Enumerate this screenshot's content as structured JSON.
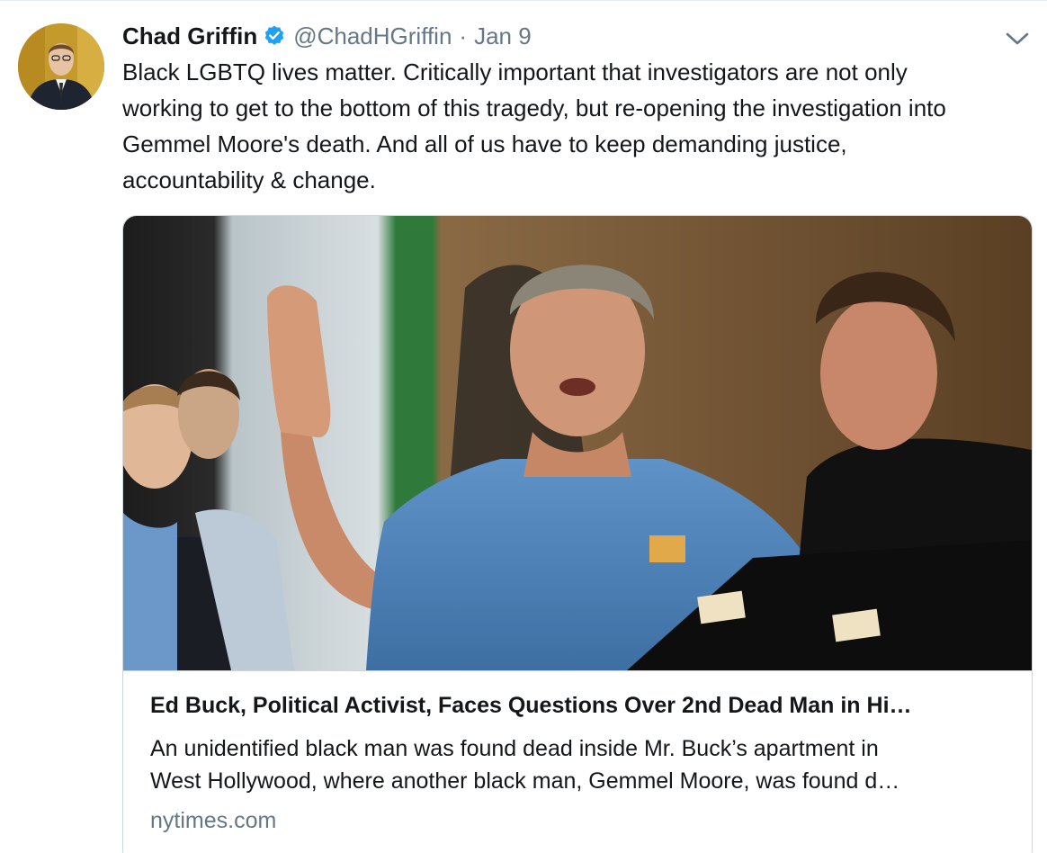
{
  "author": {
    "display_name": "Chad Griffin",
    "handle": "@ChadHGriffin",
    "separator": "·",
    "date": "Jan 9",
    "verified": true,
    "avatar_icon": "profile-photo"
  },
  "tweet": {
    "text_lines": [
      "Black LGBTQ lives matter. Critically important that investigators are not only",
      "working to get to the bottom of this tragedy, but re-opening the investigation into",
      "Gemmel Moore's death. And all of us have to keep demanding justice,",
      "accountability & change."
    ]
  },
  "card": {
    "title": "Ed Buck, Political Activist, Faces Questions Over 2nd Dead Man in Hi…",
    "description_lines": [
      "An unidentified black man was found dead inside Mr. Buck’s apartment in",
      "West Hollywood, where another black man, Gemmel Moore, was found d…"
    ],
    "domain": "nytimes.com"
  },
  "icons": {
    "verified": "verified-badge-icon",
    "caret": "chevron-down-icon"
  },
  "colors": {
    "verified_blue": "#1da1f2",
    "secondary_text": "#657786",
    "border": "#ccd6dd"
  }
}
